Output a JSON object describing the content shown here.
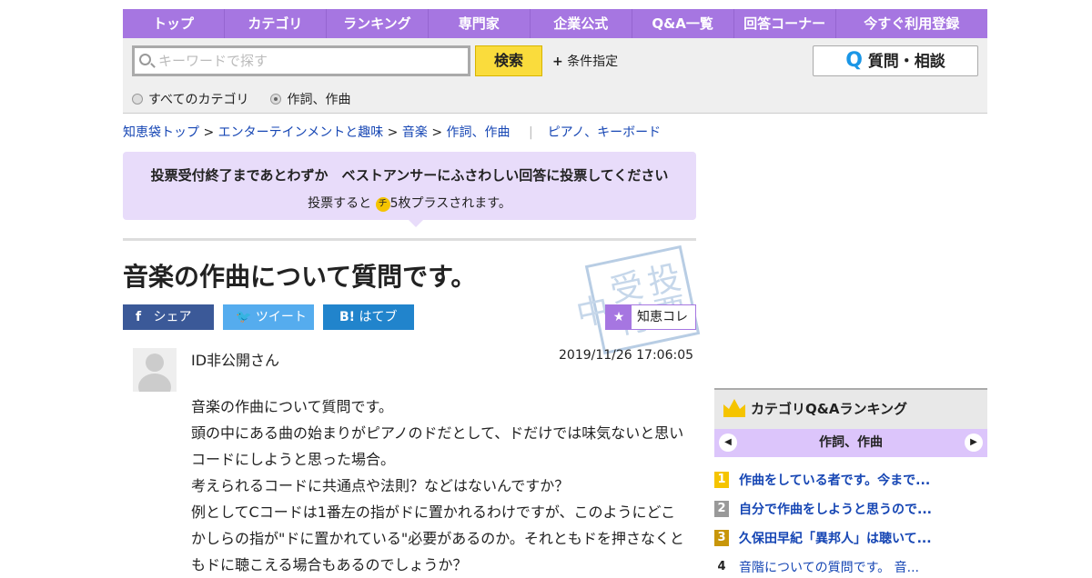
{
  "nav": [
    "トップ",
    "カテゴリ",
    "ランキング",
    "専門家",
    "企業公式",
    "Q&A一覧",
    "回答コーナー",
    "今すぐ利用登録"
  ],
  "search": {
    "placeholder": "キーワードで探す",
    "button": "検索",
    "conditions": "条件指定",
    "ask_button": "質問・相談",
    "ask_icon": "Q",
    "scope_all": "すべてのカテゴリ",
    "scope_cat": "作詞、作曲"
  },
  "breadcrumb": [
    "知恵袋トップ",
    "エンターテインメントと趣味",
    "音楽",
    "作詞、作曲",
    "ピアノ、キーボード"
  ],
  "vote": {
    "title": "投票受付終了まであとわずか　ベストアンサーにふさわしい回答に投票してください",
    "pre": "投票すると",
    "coin": "チ",
    "post": "5枚プラスされます。"
  },
  "question": {
    "title": "音楽の作曲について質問です。",
    "stamp": "投票受付中",
    "user": "ID非公開さん",
    "date": "2019/11/26  17:06:05",
    "body": [
      "音楽の作曲について質問です。",
      "頭の中にある曲の始まりがピアノのドだとして、ドだけでは味気ないと思いコードにしようと思った場合。",
      "考えられるコードに共通点や法則？などはないんですか？",
      "例としてCコードは1番左の指がドに置かれるわけですが、このようにどこかしらの指が\"ドに置かれている\"必要があるのか。それともドを押さなくともドに聴こえる場合もあるのでしょうか？"
    ]
  },
  "share": {
    "facebook": "シェア",
    "twitter": "ツイート",
    "hatena": "はてブ",
    "chiekore": "知恵コレ"
  },
  "ranking": {
    "title": "カテゴリQ&Aランキング",
    "category": "作詞、作曲",
    "items": [
      {
        "n": "1",
        "text": "作曲をしている者です。今まで...",
        "color": "#f5c400"
      },
      {
        "n": "2",
        "text": "自分で作曲をしようと思うので...",
        "color": "#999999"
      },
      {
        "n": "3",
        "text": "久保田早紀「異邦人」は聴いて...",
        "color": "#c8960a"
      },
      {
        "n": "4",
        "text": "音階についての質問です。 音...",
        "color": ""
      }
    ]
  }
}
